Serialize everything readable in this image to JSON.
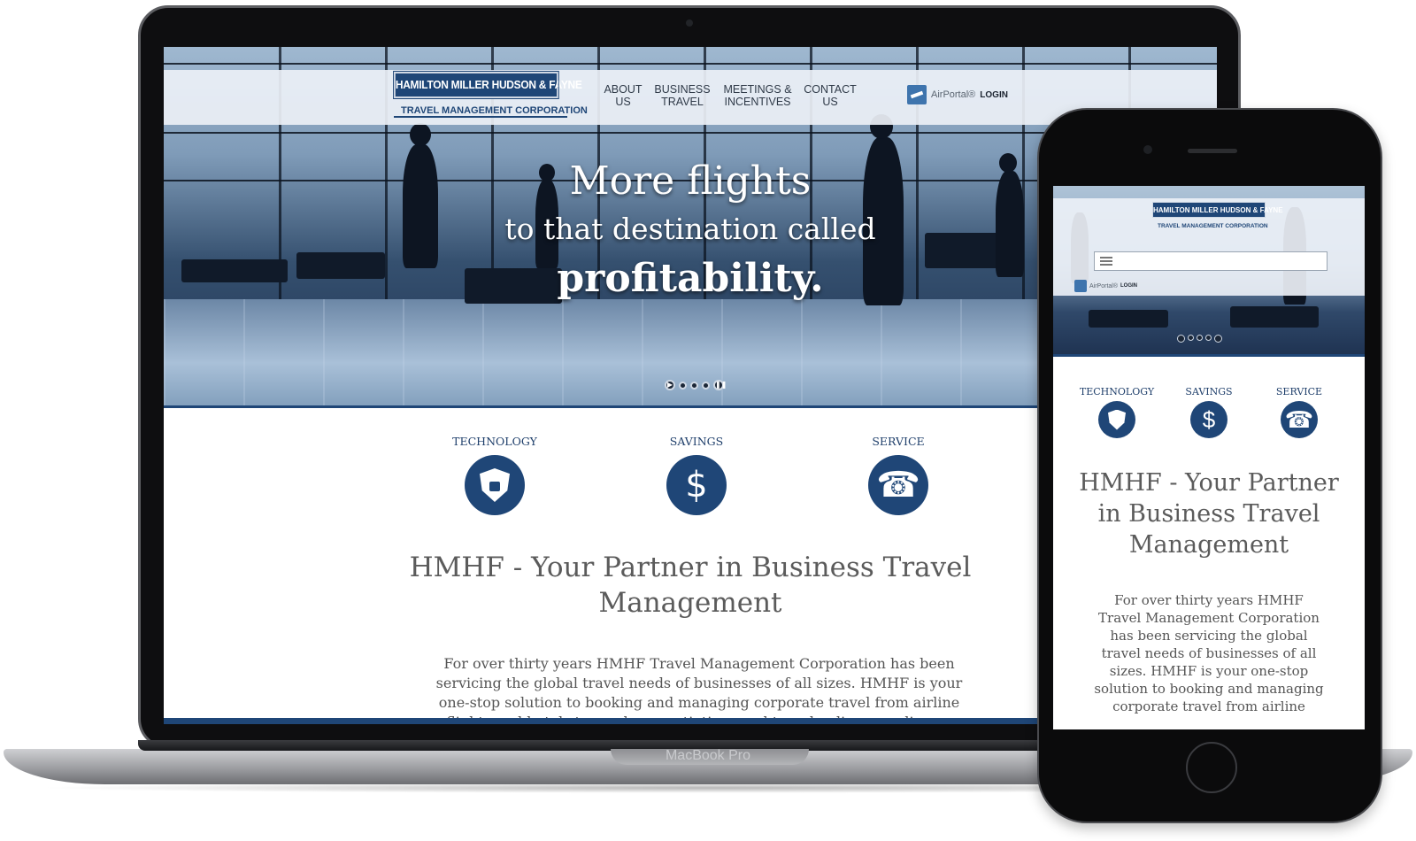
{
  "devices": {
    "laptop_label": "MacBook Pro"
  },
  "site": {
    "logo": {
      "name": "HAMILTON MILLER HUDSON & FAYNE",
      "subtitle": "TRAVEL MANAGEMENT CORPORATION"
    },
    "nav": [
      {
        "label": "ABOUT\nUS"
      },
      {
        "label": "BUSINESS\nTRAVEL"
      },
      {
        "label": "MEETINGS &\nINCENTIVES"
      },
      {
        "label": "CONTACT\nUS"
      }
    ],
    "airportal": {
      "brand": "AirPortal®",
      "login": "LOGIN"
    },
    "hero": {
      "line1": "More flights",
      "line2": "to that destination called",
      "line3": "profitability."
    },
    "slider_controls": {
      "play": "▶",
      "pause": "❚❚"
    },
    "features": [
      {
        "title": "TECHNOLOGY",
        "icon": "lock-shield-icon"
      },
      {
        "title": "SAVINGS",
        "icon": "dollar-icon",
        "glyph": "$"
      },
      {
        "title": "SERVICE",
        "icon": "headset-icon",
        "glyph": "☎"
      }
    ],
    "heading": "HMHF - Your Partner in Business Travel Management",
    "paragraph_desktop": "For over thirty years HMHF Travel Management Corporation has been servicing the global travel needs of businesses of all sizes. HMHF is your one-stop solution to booking and managing corporate travel from airline flights and hotels to vendor negotiations and travel policy compliance.",
    "paragraph_mobile": "For over thirty years HMHF Travel Management Corporation has been servicing the global travel needs of businesses of all sizes. HMHF is your one-stop solution to booking and managing corporate travel from airline"
  },
  "colors": {
    "brand_navy": "#1f4677",
    "text_gray": "#5b5b5b"
  }
}
